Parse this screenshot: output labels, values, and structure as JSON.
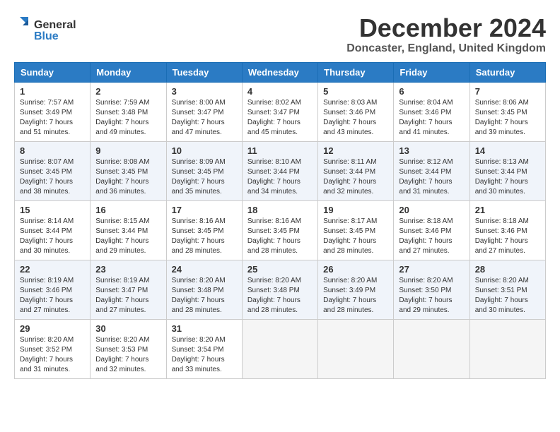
{
  "logo": {
    "line1": "General",
    "line2": "Blue"
  },
  "title": "December 2024",
  "location": "Doncaster, England, United Kingdom",
  "days_of_week": [
    "Sunday",
    "Monday",
    "Tuesday",
    "Wednesday",
    "Thursday",
    "Friday",
    "Saturday"
  ],
  "weeks": [
    [
      {
        "day": "1",
        "sunrise": "Sunrise: 7:57 AM",
        "sunset": "Sunset: 3:49 PM",
        "daylight": "Daylight: 7 hours and 51 minutes."
      },
      {
        "day": "2",
        "sunrise": "Sunrise: 7:59 AM",
        "sunset": "Sunset: 3:48 PM",
        "daylight": "Daylight: 7 hours and 49 minutes."
      },
      {
        "day": "3",
        "sunrise": "Sunrise: 8:00 AM",
        "sunset": "Sunset: 3:47 PM",
        "daylight": "Daylight: 7 hours and 47 minutes."
      },
      {
        "day": "4",
        "sunrise": "Sunrise: 8:02 AM",
        "sunset": "Sunset: 3:47 PM",
        "daylight": "Daylight: 7 hours and 45 minutes."
      },
      {
        "day": "5",
        "sunrise": "Sunrise: 8:03 AM",
        "sunset": "Sunset: 3:46 PM",
        "daylight": "Daylight: 7 hours and 43 minutes."
      },
      {
        "day": "6",
        "sunrise": "Sunrise: 8:04 AM",
        "sunset": "Sunset: 3:46 PM",
        "daylight": "Daylight: 7 hours and 41 minutes."
      },
      {
        "day": "7",
        "sunrise": "Sunrise: 8:06 AM",
        "sunset": "Sunset: 3:45 PM",
        "daylight": "Daylight: 7 hours and 39 minutes."
      }
    ],
    [
      {
        "day": "8",
        "sunrise": "Sunrise: 8:07 AM",
        "sunset": "Sunset: 3:45 PM",
        "daylight": "Daylight: 7 hours and 38 minutes."
      },
      {
        "day": "9",
        "sunrise": "Sunrise: 8:08 AM",
        "sunset": "Sunset: 3:45 PM",
        "daylight": "Daylight: 7 hours and 36 minutes."
      },
      {
        "day": "10",
        "sunrise": "Sunrise: 8:09 AM",
        "sunset": "Sunset: 3:45 PM",
        "daylight": "Daylight: 7 hours and 35 minutes."
      },
      {
        "day": "11",
        "sunrise": "Sunrise: 8:10 AM",
        "sunset": "Sunset: 3:44 PM",
        "daylight": "Daylight: 7 hours and 34 minutes."
      },
      {
        "day": "12",
        "sunrise": "Sunrise: 8:11 AM",
        "sunset": "Sunset: 3:44 PM",
        "daylight": "Daylight: 7 hours and 32 minutes."
      },
      {
        "day": "13",
        "sunrise": "Sunrise: 8:12 AM",
        "sunset": "Sunset: 3:44 PM",
        "daylight": "Daylight: 7 hours and 31 minutes."
      },
      {
        "day": "14",
        "sunrise": "Sunrise: 8:13 AM",
        "sunset": "Sunset: 3:44 PM",
        "daylight": "Daylight: 7 hours and 30 minutes."
      }
    ],
    [
      {
        "day": "15",
        "sunrise": "Sunrise: 8:14 AM",
        "sunset": "Sunset: 3:44 PM",
        "daylight": "Daylight: 7 hours and 30 minutes."
      },
      {
        "day": "16",
        "sunrise": "Sunrise: 8:15 AM",
        "sunset": "Sunset: 3:44 PM",
        "daylight": "Daylight: 7 hours and 29 minutes."
      },
      {
        "day": "17",
        "sunrise": "Sunrise: 8:16 AM",
        "sunset": "Sunset: 3:45 PM",
        "daylight": "Daylight: 7 hours and 28 minutes."
      },
      {
        "day": "18",
        "sunrise": "Sunrise: 8:16 AM",
        "sunset": "Sunset: 3:45 PM",
        "daylight": "Daylight: 7 hours and 28 minutes."
      },
      {
        "day": "19",
        "sunrise": "Sunrise: 8:17 AM",
        "sunset": "Sunset: 3:45 PM",
        "daylight": "Daylight: 7 hours and 28 minutes."
      },
      {
        "day": "20",
        "sunrise": "Sunrise: 8:18 AM",
        "sunset": "Sunset: 3:46 PM",
        "daylight": "Daylight: 7 hours and 27 minutes."
      },
      {
        "day": "21",
        "sunrise": "Sunrise: 8:18 AM",
        "sunset": "Sunset: 3:46 PM",
        "daylight": "Daylight: 7 hours and 27 minutes."
      }
    ],
    [
      {
        "day": "22",
        "sunrise": "Sunrise: 8:19 AM",
        "sunset": "Sunset: 3:46 PM",
        "daylight": "Daylight: 7 hours and 27 minutes."
      },
      {
        "day": "23",
        "sunrise": "Sunrise: 8:19 AM",
        "sunset": "Sunset: 3:47 PM",
        "daylight": "Daylight: 7 hours and 27 minutes."
      },
      {
        "day": "24",
        "sunrise": "Sunrise: 8:20 AM",
        "sunset": "Sunset: 3:48 PM",
        "daylight": "Daylight: 7 hours and 28 minutes."
      },
      {
        "day": "25",
        "sunrise": "Sunrise: 8:20 AM",
        "sunset": "Sunset: 3:48 PM",
        "daylight": "Daylight: 7 hours and 28 minutes."
      },
      {
        "day": "26",
        "sunrise": "Sunrise: 8:20 AM",
        "sunset": "Sunset: 3:49 PM",
        "daylight": "Daylight: 7 hours and 28 minutes."
      },
      {
        "day": "27",
        "sunrise": "Sunrise: 8:20 AM",
        "sunset": "Sunset: 3:50 PM",
        "daylight": "Daylight: 7 hours and 29 minutes."
      },
      {
        "day": "28",
        "sunrise": "Sunrise: 8:20 AM",
        "sunset": "Sunset: 3:51 PM",
        "daylight": "Daylight: 7 hours and 30 minutes."
      }
    ],
    [
      {
        "day": "29",
        "sunrise": "Sunrise: 8:20 AM",
        "sunset": "Sunset: 3:52 PM",
        "daylight": "Daylight: 7 hours and 31 minutes."
      },
      {
        "day": "30",
        "sunrise": "Sunrise: 8:20 AM",
        "sunset": "Sunset: 3:53 PM",
        "daylight": "Daylight: 7 hours and 32 minutes."
      },
      {
        "day": "31",
        "sunrise": "Sunrise: 8:20 AM",
        "sunset": "Sunset: 3:54 PM",
        "daylight": "Daylight: 7 hours and 33 minutes."
      },
      null,
      null,
      null,
      null
    ]
  ]
}
